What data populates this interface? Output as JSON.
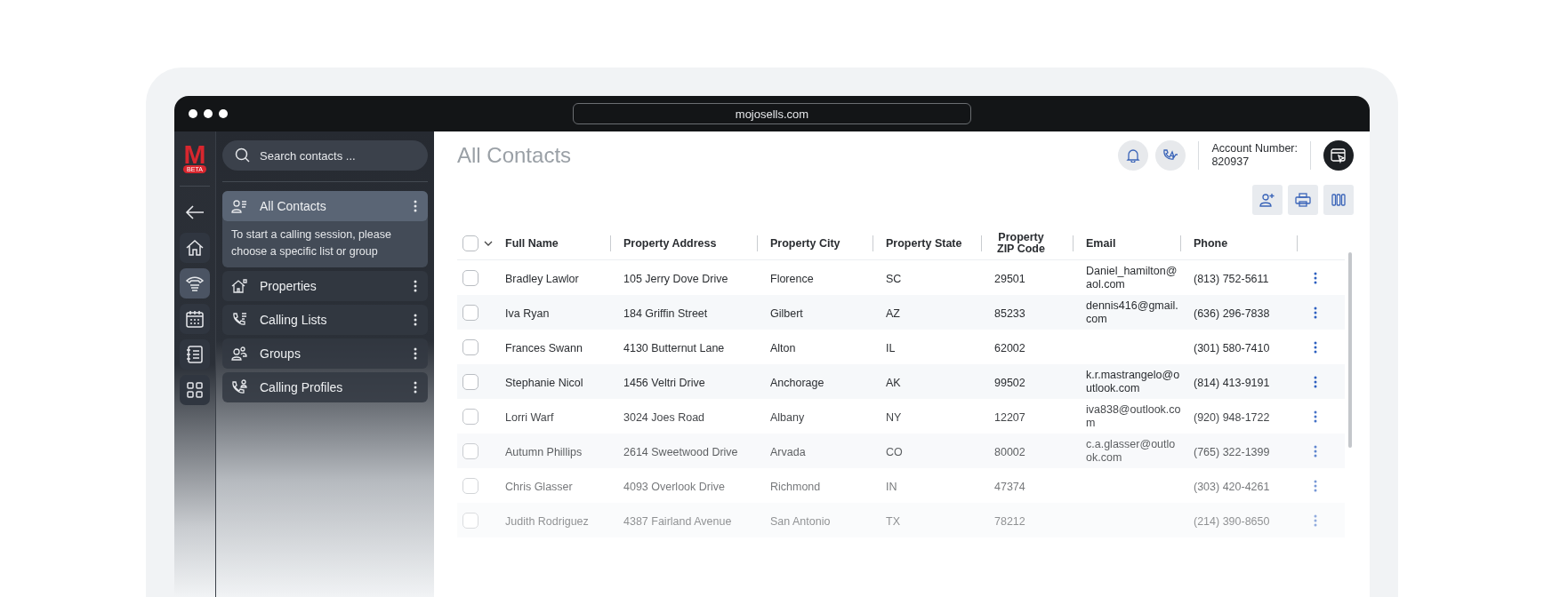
{
  "browser": {
    "url": "mojosells.com"
  },
  "sidebar": {
    "logo": "M",
    "badge": "BETA",
    "rail": [
      {
        "kind": "back",
        "selected": false
      },
      {
        "kind": "home",
        "selected": false
      },
      {
        "kind": "phone",
        "selected": true
      },
      {
        "kind": "calendar",
        "selected": false
      },
      {
        "kind": "notes",
        "selected": false
      },
      {
        "kind": "grid",
        "selected": false
      }
    ],
    "search": {
      "placeholder": "Search contacts ..."
    },
    "items": [
      {
        "kind": "contacts",
        "label": "All Contacts",
        "selected": true,
        "note": "To start a calling session, please choose a specific list or group"
      },
      {
        "kind": "properties",
        "label": "Properties",
        "selected": false
      },
      {
        "kind": "calling-list",
        "label": "Calling Lists",
        "selected": false
      },
      {
        "kind": "groups",
        "label": "Groups",
        "selected": false
      },
      {
        "kind": "calling-profile",
        "label": "Calling Profiles",
        "selected": false
      }
    ]
  },
  "header": {
    "title": "All Contacts",
    "account_label": "Account Number:",
    "account_number": "820937"
  },
  "table": {
    "select_all": {
      "checked": false
    },
    "columns": [
      "Full Name",
      "Property Address",
      "Property City",
      "Property State",
      "Property ZIP Code",
      "Email",
      "Phone"
    ],
    "rows": [
      {
        "checked": false,
        "cells": [
          "Bradley Lawlor",
          "105 Jerry Dove Drive",
          "Florence",
          "SC",
          "29501",
          "Daniel_hamilton@aol.com",
          "(813) 752-5611"
        ]
      },
      {
        "checked": false,
        "cells": [
          "Iva Ryan",
          "184 Griffin Street",
          "Gilbert",
          "AZ",
          "85233",
          "dennis416@gmail.com",
          "(636) 296-7838"
        ]
      },
      {
        "checked": false,
        "cells": [
          "Frances Swann",
          "4130 Butternut Lane",
          "Alton",
          "IL",
          "62002",
          "",
          "(301) 580-7410"
        ]
      },
      {
        "checked": false,
        "cells": [
          "Stephanie Nicol",
          "1456 Veltri Drive",
          "Anchorage",
          "AK",
          "99502",
          "k.r.mastrangelo@outlook.com",
          "(814) 413-9191"
        ]
      },
      {
        "checked": false,
        "cells": [
          "Lorri Warf",
          "3024 Joes Road",
          "Albany",
          "NY",
          "12207",
          "iva838@outlook.com",
          "(920) 948-1722"
        ]
      },
      {
        "checked": false,
        "cells": [
          "Autumn Phillips",
          "2614 Sweetwood Drive",
          "Arvada",
          "CO",
          "80002",
          "c.a.glasser@outlook.com",
          "(765) 322-1399"
        ]
      },
      {
        "checked": false,
        "cells": [
          "Chris Glasser",
          "4093 Overlook Drive",
          "Richmond",
          "IN",
          "47374",
          "",
          "(303) 420-4261"
        ]
      },
      {
        "checked": false,
        "cells": [
          "Judith Rodriguez",
          "4387 Fairland Avenue",
          "San Antonio",
          "TX",
          "78212",
          "",
          "(214) 390-8650"
        ]
      }
    ]
  }
}
